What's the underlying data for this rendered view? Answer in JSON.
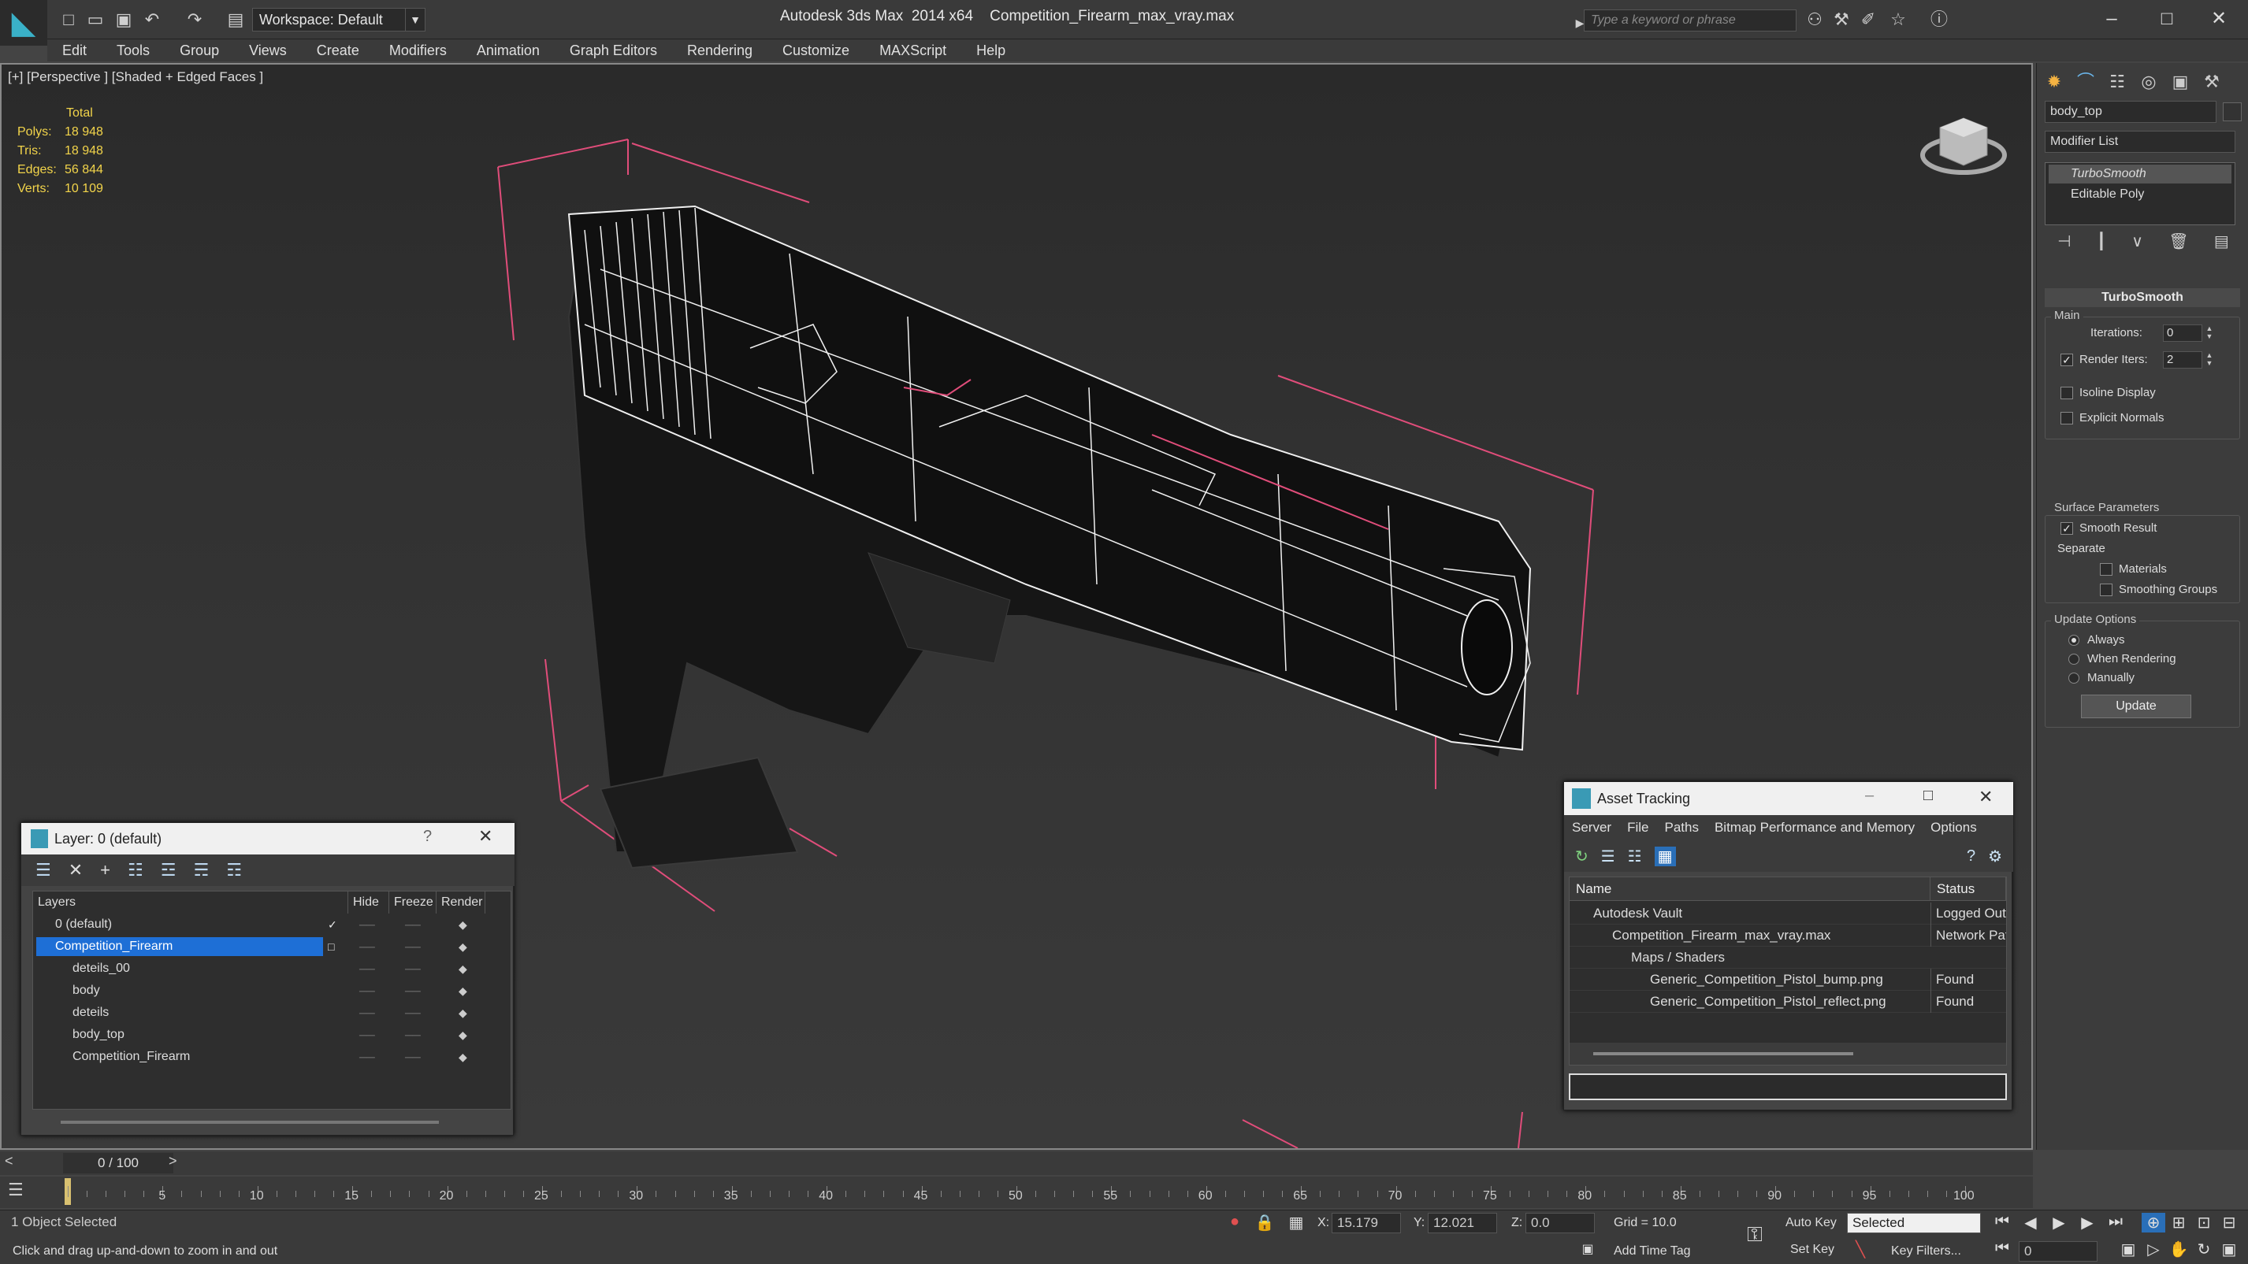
{
  "window": {
    "app_title": "Autodesk 3ds Max  2014 x64",
    "file_title": "Competition_Firearm_max_vray.max",
    "workspace": "Workspace: Default",
    "search_placeholder": "Type a keyword or phrase"
  },
  "menu": [
    "Edit",
    "Tools",
    "Group",
    "Views",
    "Create",
    "Modifiers",
    "Animation",
    "Graph Editors",
    "Rendering",
    "Customize",
    "MAXScript",
    "Help"
  ],
  "viewport": {
    "label": "[+] [Perspective ] [Shaded + Edged Faces ]",
    "stats": {
      "header": "Total",
      "polys_label": "Polys:",
      "polys": "18 948",
      "tris_label": "Tris:",
      "tris": "18 948",
      "edges_label": "Edges:",
      "edges": "56 844",
      "verts_label": "Verts:",
      "verts": "10 109"
    }
  },
  "command_panel": {
    "object_name": "body_top",
    "modifier_list": "Modifier List",
    "stack": [
      "TurboSmooth",
      "Editable Poly"
    ],
    "rollout_title": "TurboSmooth",
    "main_group": "Main",
    "iterations_label": "Iterations:",
    "iterations": "0",
    "render_iters_label": "Render Iters:",
    "render_iters": "2",
    "isoline": "Isoline Display",
    "explicit_normals": "Explicit Normals",
    "surface_group": "Surface Parameters",
    "smooth_result": "Smooth Result",
    "separate": "Separate",
    "materials": "Materials",
    "smoothing_groups": "Smoothing Groups",
    "update_group": "Update Options",
    "always": "Always",
    "when_rendering": "When Rendering",
    "manually": "Manually",
    "update_button": "Update"
  },
  "layer_dialog": {
    "title": "Layer: 0 (default)",
    "columns": [
      "Layers",
      "Hide",
      "Freeze",
      "Render"
    ],
    "rows": [
      {
        "name": "0 (default)"
      },
      {
        "name": "Competition_Firearm"
      },
      {
        "name": "detеils_00"
      },
      {
        "name": "body"
      },
      {
        "name": "deteils"
      },
      {
        "name": "body_top"
      },
      {
        "name": "Competition_Firearm"
      }
    ]
  },
  "asset_dialog": {
    "title": "Asset Tracking",
    "menu": [
      "Server",
      "File",
      "Paths",
      "Bitmap Performance and Memory",
      "Options"
    ],
    "columns": [
      "Name",
      "Status"
    ],
    "rows": [
      {
        "name": "Autodesk Vault",
        "status": "Logged Out"
      },
      {
        "name": "Competition_Firearm_max_vray.max",
        "status": "Network Pat"
      },
      {
        "name": "Maps / Shaders",
        "status": ""
      },
      {
        "name": "Generic_Competition_Pistol_bump.png",
        "status": "Found"
      },
      {
        "name": "Generic_Competition_Pistol_reflect.png",
        "status": "Found"
      }
    ]
  },
  "timeline": {
    "frame": "0 / 100",
    "ticks": [
      "5",
      "10",
      "15",
      "20",
      "25",
      "30",
      "35",
      "40",
      "45",
      "50",
      "55",
      "60",
      "65",
      "70",
      "75",
      "80",
      "85",
      "90",
      "95",
      "100"
    ]
  },
  "status": {
    "selection": "1 Object Selected",
    "prompt": "Click and drag up-and-down to zoom in and out",
    "x_label": "X:",
    "x": "15.179",
    "y_label": "Y:",
    "y": "12.021",
    "z_label": "Z:",
    "z": "0.0",
    "grid": "Grid = 10.0",
    "add_time_tag": "Add Time Tag",
    "auto_key": "Auto Key",
    "set_key": "Set Key",
    "key_mode": "Selected",
    "key_filters": "Key Filters...",
    "frame_field": "0"
  }
}
